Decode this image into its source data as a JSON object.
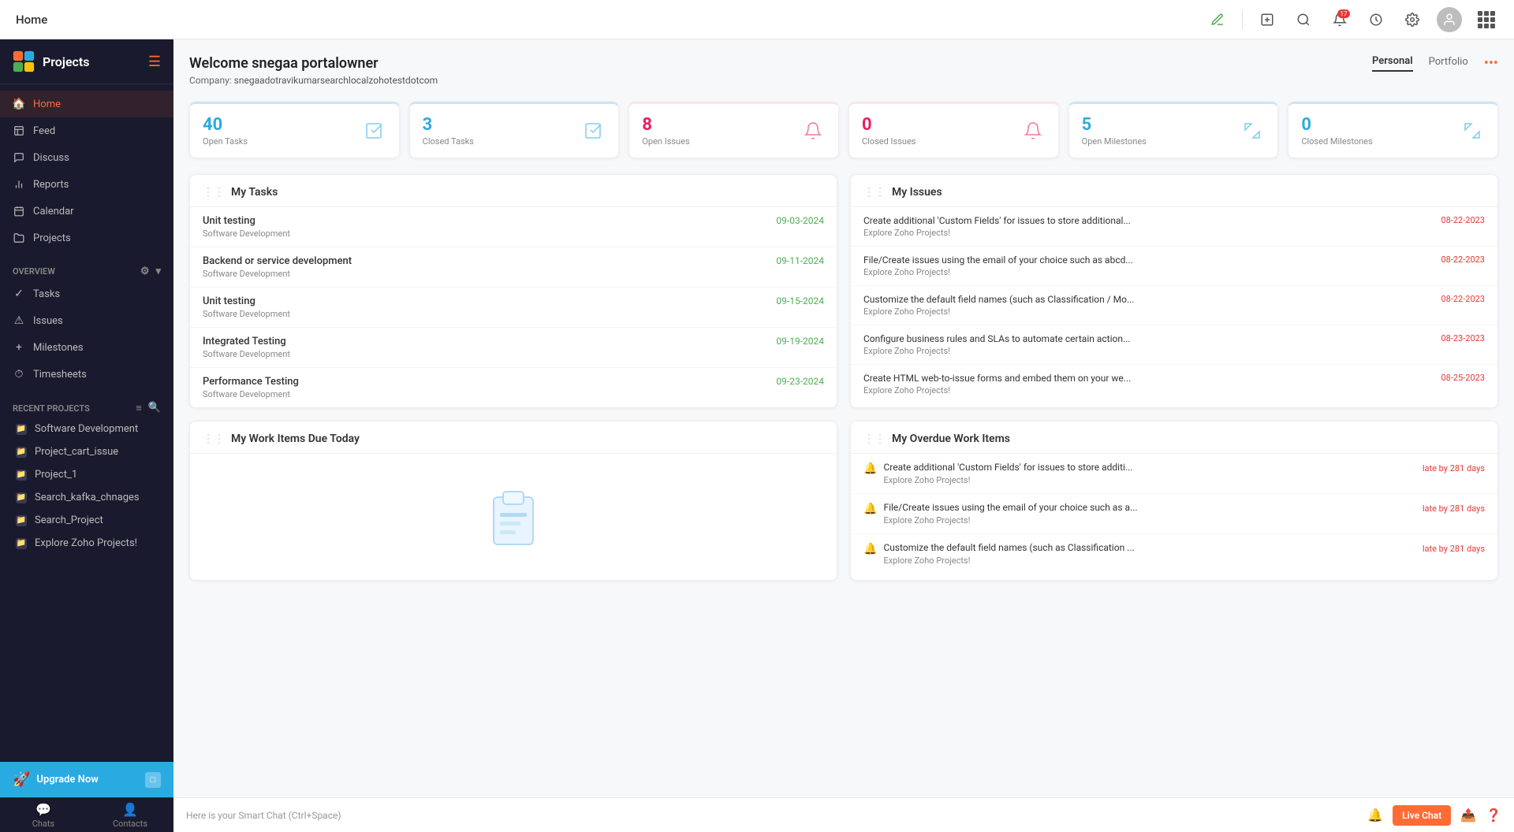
{
  "topbar": {
    "title": "Home"
  },
  "sidebar": {
    "logo_text": "Projects",
    "nav_items": [
      {
        "id": "home",
        "label": "Home",
        "icon": "🏠",
        "active": true
      },
      {
        "id": "feed",
        "label": "Feed",
        "icon": "📋"
      },
      {
        "id": "discuss",
        "label": "Discuss",
        "icon": "💬"
      },
      {
        "id": "reports",
        "label": "Reports",
        "icon": "📊"
      },
      {
        "id": "calendar",
        "label": "Calendar",
        "icon": "📅"
      },
      {
        "id": "projects",
        "label": "Projects",
        "icon": "📁"
      }
    ],
    "overview_section": "Overview",
    "overview_items": [
      {
        "label": "Tasks",
        "icon": "✓"
      },
      {
        "label": "Issues",
        "icon": "⚠"
      },
      {
        "label": "Milestones",
        "icon": "+"
      },
      {
        "label": "Timesheets",
        "icon": "⏱"
      }
    ],
    "recent_projects_section": "Recent Projects",
    "recent_projects": [
      {
        "label": "Software Development"
      },
      {
        "label": "Project_cart_issue"
      },
      {
        "label": "Project_1"
      },
      {
        "label": "Search_kafka_chnages"
      },
      {
        "label": "Search_Project"
      },
      {
        "label": "Explore Zoho Projects!"
      }
    ],
    "upgrade_label": "Upgrade Now",
    "bottom_tabs": [
      {
        "label": "Chats",
        "icon": "💬"
      },
      {
        "label": "Contacts",
        "icon": "👤"
      }
    ]
  },
  "welcome": {
    "title": "Welcome snegaa portalowner",
    "company_label": "Company:",
    "company": "snegaadotravikumarsearchlocalzohotestdotcom",
    "tab_personal": "Personal",
    "tab_portfolio": "Portfolio"
  },
  "stats": [
    {
      "id": "open-tasks",
      "number": "40",
      "label": "Open Tasks",
      "color": "blue",
      "icon": "☑"
    },
    {
      "id": "closed-tasks",
      "number": "3",
      "label": "Closed Tasks",
      "color": "blue",
      "icon": "☑"
    },
    {
      "id": "open-issues",
      "number": "8",
      "label": "Open Issues",
      "color": "pink",
      "icon": "🔔"
    },
    {
      "id": "closed-issues",
      "number": "0",
      "label": "Closed Issues",
      "color": "pink",
      "icon": "🔔"
    },
    {
      "id": "open-milestones",
      "number": "5",
      "label": "Open Milestones",
      "color": "blue",
      "icon": "⚑"
    },
    {
      "id": "closed-milestones",
      "number": "0",
      "label": "Closed Milestones",
      "color": "blue",
      "icon": "⚑"
    }
  ],
  "my_tasks": {
    "title": "My Tasks",
    "items": [
      {
        "name": "Unit testing",
        "project": "Software Development",
        "date": "09-03-2024"
      },
      {
        "name": "Backend or service development",
        "project": "Software Development",
        "date": "09-11-2024"
      },
      {
        "name": "Unit testing",
        "project": "Software Development",
        "date": "09-15-2024"
      },
      {
        "name": "Integrated Testing",
        "project": "Software Development",
        "date": "09-19-2024"
      },
      {
        "name": "Performance Testing",
        "project": "Software Development",
        "date": "09-23-2024"
      }
    ]
  },
  "my_issues": {
    "title": "My Issues",
    "items": [
      {
        "title": "Create additional 'Custom Fields' for issues to store additional...",
        "subtitle": "Explore Zoho Projects!",
        "date": "08-22-2023"
      },
      {
        "title": "File/Create issues using the email of your choice such as abcd...",
        "subtitle": "Explore Zoho Projects!",
        "date": "08-22-2023"
      },
      {
        "title": "Customize the default field names (such as Classification / Mo...",
        "subtitle": "Explore Zoho Projects!",
        "date": "08-22-2023"
      },
      {
        "title": "Configure business rules and SLAs to automate certain action...",
        "subtitle": "Explore Zoho Projects!",
        "date": "08-23-2023"
      },
      {
        "title": "Create HTML web-to-issue forms and embed them on your we...",
        "subtitle": "Explore Zoho Projects!",
        "date": "08-25-2023"
      }
    ]
  },
  "my_work_items": {
    "title": "My Work Items Due Today",
    "empty": true
  },
  "my_overdue": {
    "title": "My Overdue Work Items",
    "items": [
      {
        "title": "Create additional 'Custom Fields' for issues to store additi...",
        "subtitle": "Explore Zoho Projects!",
        "late": "late by 281 days"
      },
      {
        "title": "File/Create issues using the email of your choice such as a...",
        "subtitle": "Explore Zoho Projects!",
        "late": "late by 281 days"
      },
      {
        "title": "Customize the default field names (such as Classification ...",
        "subtitle": "Explore Zoho Projects!",
        "late": "late by 281 days"
      }
    ]
  },
  "chatbar": {
    "placeholder": "Here is your Smart Chat (Ctrl+Space)",
    "live_chat": "Live Chat"
  },
  "colors": {
    "orange": "#ff6b35",
    "blue": "#29abe2",
    "sidebar_bg": "#1a1a2e"
  }
}
